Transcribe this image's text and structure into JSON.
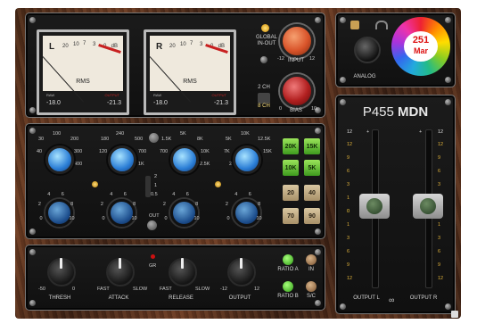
{
  "meter_left": {
    "channel": "L",
    "scale": [
      "20",
      "10",
      "7",
      "5",
      "3",
      "1",
      "0",
      "1",
      "2",
      "3"
    ],
    "unit": "dB",
    "mode": "RMS",
    "raw_label": "RAW",
    "raw_value": "-18.0",
    "output_label": "OUTPUT",
    "output_value": "-21.3"
  },
  "meter_right": {
    "channel": "R",
    "scale": [
      "20",
      "10",
      "7",
      "5",
      "3",
      "1",
      "0",
      "1",
      "2",
      "3"
    ],
    "unit": "dB",
    "mode": "RMS",
    "raw_label": "RAW",
    "raw_value": "-18.0",
    "output_label": "OUTPUT",
    "output_value": "-21.3"
  },
  "global": {
    "global_in_out": "GLOBAL\nIN-OUT",
    "input": "INPUT",
    "input_min": "-12",
    "input_max": "12",
    "bias": "BIAS",
    "bias_min": "0",
    "bias_max": "10",
    "channel_mode": "2 CH",
    "channel_sel": "8 CH"
  },
  "logo_panel": {
    "label": "ANALOG",
    "badge_line1": "251",
    "badge_line2": "Mar"
  },
  "eq": {
    "freqs": [
      {
        "labels": [
          "100",
          "200",
          "300",
          "400",
          "30",
          "40",
          "50"
        ]
      },
      {
        "labels": [
          "240",
          "500",
          "700",
          "1K",
          "180",
          "120",
          "100"
        ]
      },
      {
        "labels": [
          "5K",
          "5K",
          "8K",
          "10K",
          "12.5K",
          "1.5K",
          "700"
        ]
      },
      {
        "labels": [
          "10K",
          "12.5K",
          "15K",
          "5K",
          "7K",
          "2.5K"
        ]
      }
    ],
    "hpf_options": [
      "20K",
      "15K",
      "10K",
      "5K"
    ],
    "lpf_options": [
      "20",
      "40",
      "70",
      "90"
    ],
    "q_labels": [
      "2",
      "1",
      "0.5"
    ],
    "out_label": "OUT"
  },
  "dynamics": {
    "thresh": "THRESH",
    "thresh_min": "-50",
    "thresh_max": "0",
    "attack": "ATTACK",
    "attack_fast": "FAST",
    "attack_slow": "SLOW",
    "release": "RELEASE",
    "release_fast": "FAST",
    "release_slow": "SLOW",
    "output": "OUTPUT",
    "output_min": "-12",
    "output_max": "12",
    "gr": "GR",
    "ratio_a": "RATIO A",
    "ratio_b": "RATIO B",
    "in": "IN",
    "sc": "S/C"
  },
  "fader_panel": {
    "title_prefix": "P455",
    "title_suffix": " MDN",
    "plus": "+",
    "scale": [
      "12",
      "9",
      "6",
      "3",
      "1",
      "0",
      "1",
      "3",
      "6",
      "9",
      "12"
    ],
    "output_l": "OUTPUT L",
    "output_r": "OUTPUT R"
  },
  "colors": {
    "accent_blue": "#2b7ed6",
    "led_green": "#3e9b1e",
    "knob_orange": "#d9542a",
    "knob_red": "#b22020"
  }
}
